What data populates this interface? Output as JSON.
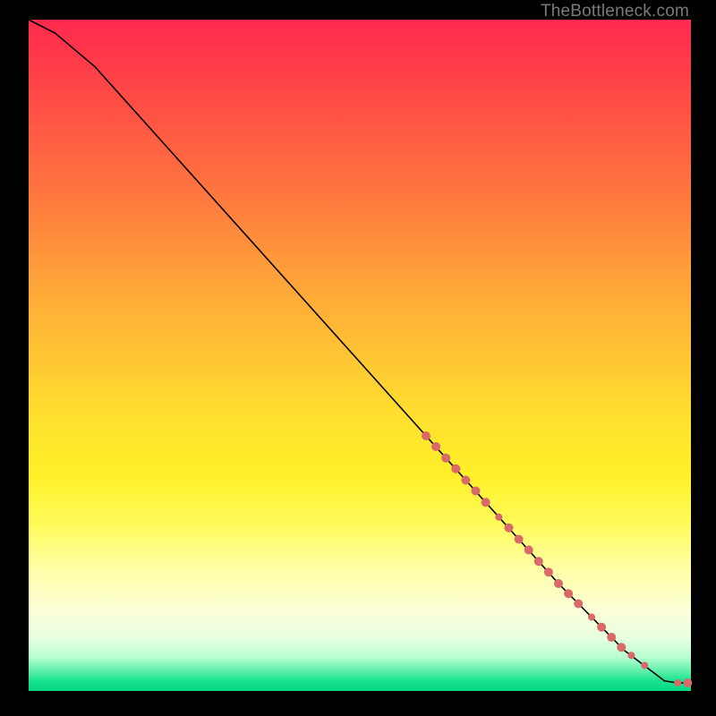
{
  "attribution": "TheBottleneck.com",
  "chart_data": {
    "type": "line",
    "title": "",
    "xlabel": "",
    "ylabel": "",
    "xlim": [
      0,
      100
    ],
    "ylim": [
      0,
      100
    ],
    "grid": false,
    "legend": false,
    "curve": {
      "name": "curve",
      "x": [
        0,
        4,
        10,
        20,
        30,
        40,
        50,
        60,
        70,
        80,
        90,
        96,
        98,
        100
      ],
      "y": [
        100,
        98,
        93,
        82,
        71,
        60,
        49,
        38,
        27,
        16,
        6,
        1.5,
        1.2,
        1.2
      ],
      "stroke": "#000000",
      "stroke_width": 1.6
    },
    "markers": {
      "name": "segment-dots",
      "color": "#d96a6a",
      "points": [
        {
          "x": 60.0,
          "y": 38.0,
          "r": 5
        },
        {
          "x": 61.5,
          "y": 36.4,
          "r": 5
        },
        {
          "x": 63.0,
          "y": 34.7,
          "r": 5
        },
        {
          "x": 64.5,
          "y": 33.1,
          "r": 5
        },
        {
          "x": 66.0,
          "y": 31.4,
          "r": 5
        },
        {
          "x": 67.5,
          "y": 29.8,
          "r": 5
        },
        {
          "x": 69.0,
          "y": 28.1,
          "r": 5
        },
        {
          "x": 71.0,
          "y": 25.9,
          "r": 4
        },
        {
          "x": 72.5,
          "y": 24.3,
          "r": 5
        },
        {
          "x": 74.0,
          "y": 22.6,
          "r": 5
        },
        {
          "x": 75.5,
          "y": 21.0,
          "r": 5
        },
        {
          "x": 77.0,
          "y": 19.3,
          "r": 5
        },
        {
          "x": 78.5,
          "y": 17.7,
          "r": 5
        },
        {
          "x": 80.0,
          "y": 16.0,
          "r": 5
        },
        {
          "x": 81.5,
          "y": 14.5,
          "r": 5
        },
        {
          "x": 83.0,
          "y": 13.0,
          "r": 5
        },
        {
          "x": 85.0,
          "y": 11.0,
          "r": 4
        },
        {
          "x": 86.5,
          "y": 9.5,
          "r": 5
        },
        {
          "x": 88.0,
          "y": 8.0,
          "r": 5
        },
        {
          "x": 89.5,
          "y": 6.5,
          "r": 5
        },
        {
          "x": 91.0,
          "y": 5.3,
          "r": 4
        },
        {
          "x": 93.0,
          "y": 3.8,
          "r": 4
        },
        {
          "x": 98.0,
          "y": 1.2,
          "r": 4
        },
        {
          "x": 99.5,
          "y": 1.2,
          "r": 5
        }
      ]
    }
  }
}
